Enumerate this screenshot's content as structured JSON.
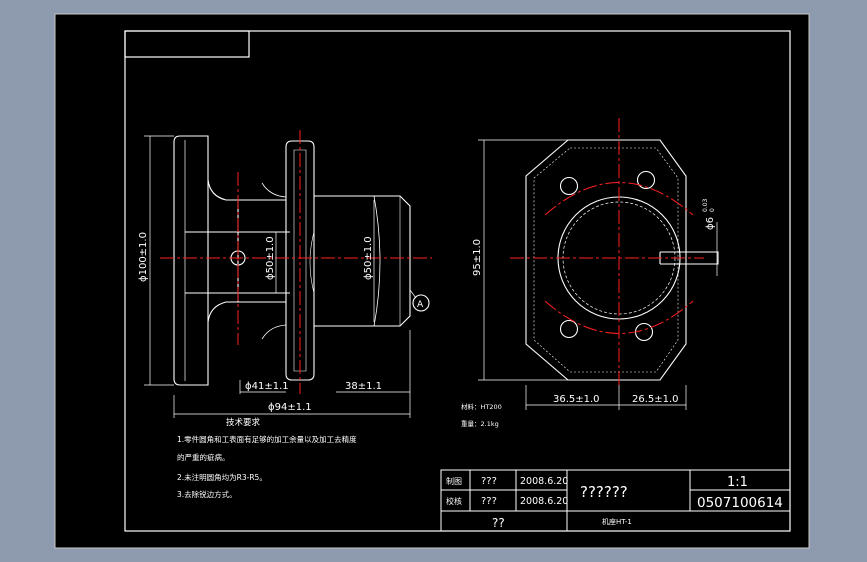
{
  "colors": {
    "background": "#8e9aae",
    "sheet": "#000000",
    "line": "#ffffff",
    "centerline": "#ff2020"
  },
  "dimensions": {
    "dia100": "ϕ100±1.0",
    "dia50_left": "ϕ50±1.0",
    "dia50_right": "ϕ50±1.0",
    "dia41": "ϕ41±1.1",
    "len38": "38±1.1",
    "dia94": "ϕ94±1.1",
    "h95": "95±1.0",
    "w36": "36.5±1.0",
    "w26": "26.5±1.0",
    "dia6_main": "ϕ6",
    "dia6_tol_upper": "0.03",
    "dia6_tol_lower": "0"
  },
  "labels": {
    "section_mark": "A",
    "material": "材料：HT200",
    "weight": "重量：2.1kg"
  },
  "tech": {
    "title": "技术要求",
    "line1": "1.零件圆角和工表面有足够的加工余量以及加工去精度",
    "line1b": "的严重的疵病。",
    "line2": "2.未注明圆角均为R3-R5。",
    "line3": "3.去除锐边方式。"
  },
  "title_block": {
    "row1_role": "制图",
    "row1_name": "???",
    "row1_date": "2008.6.20",
    "row2_role": "校核",
    "row2_name": "???",
    "row2_date": "2008.6.20",
    "part_name": "??????",
    "scale": "1:1",
    "drawing_no": "0507100614",
    "org": "??",
    "material_code": "机座HT-1"
  }
}
